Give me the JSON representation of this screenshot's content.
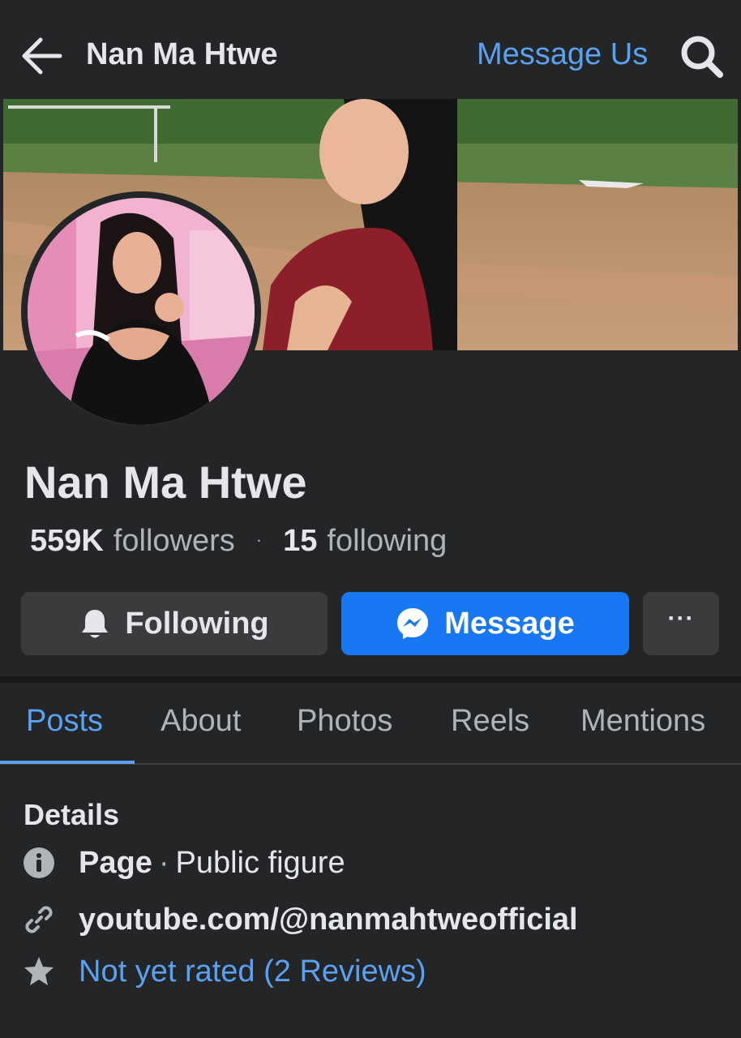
{
  "header": {
    "title": "Nan Ma Htwe",
    "message_link": "Message Us",
    "icons": [
      "back-arrow-icon",
      "search-icon"
    ]
  },
  "profile": {
    "name": "Nan Ma Htwe",
    "followers_count": "559K",
    "followers_label": "followers",
    "separator": "·",
    "following_count": "15",
    "following_label": "following"
  },
  "actions": {
    "following_label": "Following",
    "message_label": "Message",
    "more_label": "···",
    "icons": [
      "bell-icon",
      "messenger-icon",
      "more-icon"
    ]
  },
  "tabs": [
    {
      "label": "Posts",
      "active": true
    },
    {
      "label": "About",
      "active": false
    },
    {
      "label": "Photos",
      "active": false
    },
    {
      "label": "Reels",
      "active": false
    },
    {
      "label": "Mentions",
      "active": false
    }
  ],
  "details": {
    "heading": "Details",
    "page_type_label": "Page",
    "page_separator": "·",
    "page_category": "Public figure",
    "link": "youtube.com/@nanmahtweofficial",
    "rating": "Not yet rated (2 Reviews)",
    "icons": [
      "info-icon",
      "link-icon",
      "star-icon"
    ]
  },
  "colors": {
    "background": "#242526",
    "accent_blue": "#1877f2",
    "link_blue": "#5aa1f2",
    "button_gray": "#3a3b3c",
    "text_primary": "#e4e6eb",
    "text_secondary": "#b0b3b8"
  }
}
